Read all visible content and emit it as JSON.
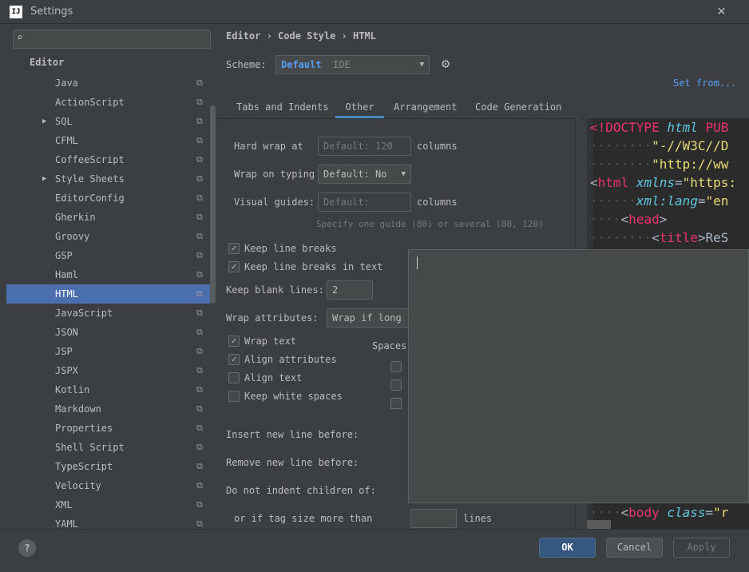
{
  "window": {
    "title": "Settings",
    "logo": "IJ"
  },
  "search": {
    "placeholder": "",
    "icon": "search-icon"
  },
  "sidebar": {
    "header": "Editor",
    "selected": "HTML",
    "items": [
      {
        "label": "Java",
        "expandable": false
      },
      {
        "label": "ActionScript",
        "expandable": false
      },
      {
        "label": "SQL",
        "expandable": true
      },
      {
        "label": "CFML",
        "expandable": false
      },
      {
        "label": "CoffeeScript",
        "expandable": false
      },
      {
        "label": "Style Sheets",
        "expandable": true
      },
      {
        "label": "EditorConfig",
        "expandable": false
      },
      {
        "label": "Gherkin",
        "expandable": false
      },
      {
        "label": "Groovy",
        "expandable": false
      },
      {
        "label": "GSP",
        "expandable": false
      },
      {
        "label": "Haml",
        "expandable": false
      },
      {
        "label": "HTML",
        "expandable": false
      },
      {
        "label": "JavaScript",
        "expandable": false
      },
      {
        "label": "JSON",
        "expandable": false
      },
      {
        "label": "JSP",
        "expandable": false
      },
      {
        "label": "JSPX",
        "expandable": false
      },
      {
        "label": "Kotlin",
        "expandable": false
      },
      {
        "label": "Markdown",
        "expandable": false
      },
      {
        "label": "Properties",
        "expandable": false
      },
      {
        "label": "Shell Script",
        "expandable": false
      },
      {
        "label": "TypeScript",
        "expandable": false
      },
      {
        "label": "Velocity",
        "expandable": false
      },
      {
        "label": "XML",
        "expandable": false
      },
      {
        "label": "YAML",
        "expandable": false
      }
    ]
  },
  "breadcrumb": [
    "Editor",
    "Code Style",
    "HTML"
  ],
  "scheme": {
    "label": "Scheme:",
    "name": "Default",
    "type": "IDE",
    "set_from": "Set from..."
  },
  "tabs": [
    "Tabs and Indents",
    "Other",
    "Arrangement",
    "Code Generation"
  ],
  "active_tab": "Other",
  "other": {
    "hard_wrap_label": "Hard wrap at",
    "hard_wrap_placeholder": "Default: 120",
    "columns": "columns",
    "wrap_typing_label": "Wrap on typing",
    "wrap_typing_value": "Default: No",
    "visual_guides_label": "Visual guides:",
    "visual_guides_placeholder": "Default:",
    "guides_hint": "Specify one guide (80) or several (80, 120)",
    "keep_line_breaks": {
      "label": "Keep line breaks",
      "checked": true
    },
    "keep_line_breaks_text": {
      "label": "Keep line breaks in text",
      "checked": true
    },
    "keep_blank_label": "Keep blank lines:",
    "keep_blank_value": "2",
    "wrap_attr_label": "Wrap attributes:",
    "wrap_attr_value": "Wrap if long",
    "wrap_text": {
      "label": "Wrap text",
      "checked": true
    },
    "align_attributes": {
      "label": "Align attributes",
      "checked": true
    },
    "align_text": {
      "label": "Align text",
      "checked": false
    },
    "keep_white": {
      "label": "Keep white spaces",
      "checked": false
    },
    "spaces_label": "Spaces",
    "insert_before": "Insert new line before:",
    "remove_before": "Remove new line before:",
    "no_indent": "Do not indent children of:",
    "tag_size_label": "or if tag size more than",
    "lines": "lines"
  },
  "preview": {
    "lines": [
      [
        [
          "t",
          "<!DOCTYPE "
        ],
        [
          "a",
          "html"
        ],
        [
          "t",
          " PUB"
        ]
      ],
      [
        [
          "d",
          "········"
        ],
        [
          "s",
          "\"-//W3C//D"
        ]
      ],
      [
        [
          "d",
          "········"
        ],
        [
          "s",
          "\"http://ww"
        ]
      ],
      [
        [
          "p",
          "<"
        ],
        [
          "t",
          "html"
        ],
        [
          "p",
          " "
        ],
        [
          "a",
          "xmlns"
        ],
        [
          "p",
          "="
        ],
        [
          "s",
          "\"https:"
        ]
      ],
      [
        [
          "d",
          "······"
        ],
        [
          "a",
          "xml:lang"
        ],
        [
          "p",
          "="
        ],
        [
          "s",
          "\"en"
        ]
      ],
      [
        [
          "d",
          "····"
        ],
        [
          "p",
          "<"
        ],
        [
          "t",
          "head"
        ],
        [
          "p",
          ">"
        ]
      ],
      [
        [
          "d",
          "········"
        ],
        [
          "p",
          "<"
        ],
        [
          "t",
          "title"
        ],
        [
          "p",
          ">ReS"
        ]
      ]
    ],
    "body_line": [
      [
        "d",
        "····"
      ],
      [
        "p",
        "<"
      ],
      [
        "t",
        "body"
      ],
      [
        "p",
        " "
      ],
      [
        "a",
        "class"
      ],
      [
        "p",
        "="
      ],
      [
        "s",
        "\"r"
      ]
    ]
  },
  "footer": {
    "help": "?",
    "ok": "OK",
    "cancel": "Cancel",
    "apply": "Apply"
  }
}
